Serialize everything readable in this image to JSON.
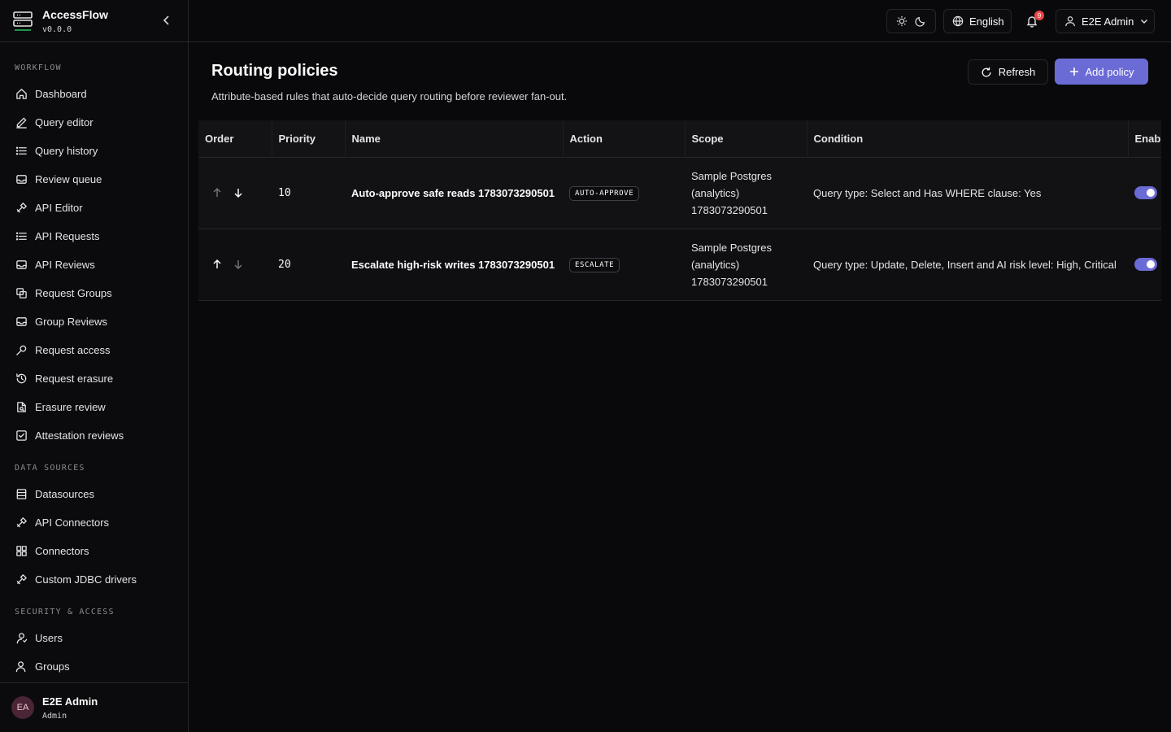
{
  "app": {
    "name": "AccessFlow",
    "version": "v0.0.0"
  },
  "sidebar": {
    "sections": {
      "workflow": "WORKFLOW",
      "data_sources": "DATA SOURCES",
      "security": "SECURITY & ACCESS"
    },
    "workflow_items": [
      {
        "label": "Dashboard",
        "icon": "home-icon"
      },
      {
        "label": "Query editor",
        "icon": "pencil-icon"
      },
      {
        "label": "Query history",
        "icon": "list-icon"
      },
      {
        "label": "Review queue",
        "icon": "inbox-icon"
      },
      {
        "label": "API Editor",
        "icon": "plug-icon"
      },
      {
        "label": "API Requests",
        "icon": "list-icon"
      },
      {
        "label": "API Reviews",
        "icon": "inbox-icon"
      },
      {
        "label": "Request Groups",
        "icon": "copy-icon"
      },
      {
        "label": "Group Reviews",
        "icon": "inbox-icon"
      },
      {
        "label": "Request access",
        "icon": "key-icon"
      },
      {
        "label": "Request erasure",
        "icon": "history-icon"
      },
      {
        "label": "Erasure review",
        "icon": "file-search-icon"
      },
      {
        "label": "Attestation reviews",
        "icon": "check-square-icon"
      }
    ],
    "data_items": [
      {
        "label": "Datasources",
        "icon": "database-icon"
      },
      {
        "label": "API Connectors",
        "icon": "plug-icon"
      },
      {
        "label": "Connectors",
        "icon": "grid-icon"
      },
      {
        "label": "Custom JDBC drivers",
        "icon": "plug-icon"
      }
    ],
    "security_items": [
      {
        "label": "Users",
        "icon": "user-icon"
      },
      {
        "label": "Groups",
        "icon": "users-icon"
      }
    ],
    "footer": {
      "initials": "EA",
      "name": "E2E Admin",
      "role": "Admin"
    }
  },
  "topbar": {
    "language": "English",
    "notifications_count": "9",
    "user": "E2E Admin"
  },
  "page": {
    "title": "Routing policies",
    "subtitle": "Attribute-based rules that auto-decide query routing before reviewer fan-out.",
    "refresh_label": "Refresh",
    "add_label": "Add policy"
  },
  "table": {
    "headers": [
      "Order",
      "Priority",
      "Name",
      "Action",
      "Scope",
      "Condition",
      "Enabl"
    ],
    "rows": [
      {
        "priority": "10",
        "name": "Auto-approve safe reads 1783073290501",
        "action": "AUTO-APPROVE",
        "scope_line1": "Sample Postgres",
        "scope_line2": "(analytics)",
        "scope_line3": "1783073290501",
        "condition": "Query type: Select and Has WHERE clause: Yes",
        "enabled": true
      },
      {
        "priority": "20",
        "name": "Escalate high-risk writes 1783073290501",
        "action": "ESCALATE",
        "scope_line1": "Sample Postgres",
        "scope_line2": "(analytics)",
        "scope_line3": "1783073290501",
        "condition": "Query type: Update, Delete, Insert and AI risk level: High, Critical",
        "enabled": true
      }
    ]
  },
  "colors": {
    "accent": "#6b6bd6",
    "badge": "#ef4444",
    "background": "#09090b"
  }
}
